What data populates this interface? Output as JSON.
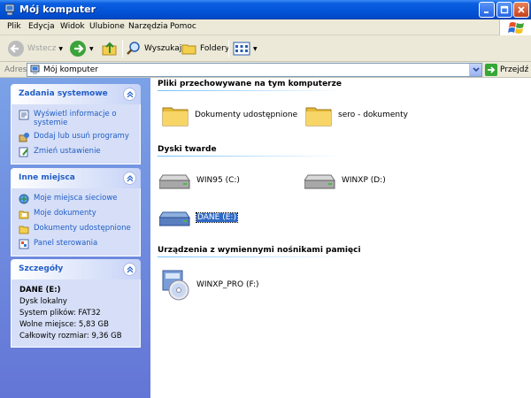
{
  "window": {
    "title": "Mój komputer"
  },
  "menu": {
    "items": [
      "Plik",
      "Edycja",
      "Widok",
      "Ulubione",
      "Narzędzia",
      "Pomoc"
    ]
  },
  "toolbar": {
    "back": "Wstecz",
    "search": "Wyszukaj",
    "folders": "Foldery"
  },
  "address": {
    "label": "Adres",
    "value": "Mój komputer",
    "go": "Przejdź"
  },
  "tasks": {
    "title": "Zadania systemowe",
    "items": [
      {
        "label": "Wyświetl informacje o systemie",
        "icon": "system-info-icon"
      },
      {
        "label": "Dodaj lub usuń programy",
        "icon": "add-remove-programs-icon"
      },
      {
        "label": "Zmień ustawienie",
        "icon": "change-settings-icon"
      }
    ]
  },
  "places": {
    "title": "Inne miejsca",
    "items": [
      {
        "label": "Moje miejsca sieciowe",
        "icon": "network-places-icon"
      },
      {
        "label": "Moje dokumenty",
        "icon": "my-documents-icon"
      },
      {
        "label": "Dokumenty udostępnione",
        "icon": "shared-folder-icon"
      },
      {
        "label": "Panel sterowania",
        "icon": "control-panel-icon"
      }
    ]
  },
  "details": {
    "title": "Szczegóły",
    "name": "DANE (E:)",
    "type": "Dysk lokalny",
    "filesystem": "System plików: FAT32",
    "free": "Wolne miejsce: 5,83 GB",
    "total": "Całkowity rozmiar: 9,36 GB"
  },
  "groups": {
    "stored": {
      "title": "Pliki przechowywane na tym komputerze",
      "items": [
        "Dokumenty udostępnione",
        "sero - dokumenty"
      ]
    },
    "hdd": {
      "title": "Dyski twarde",
      "items": [
        "WIN95 (C:)",
        "WINXP (D:)",
        "DANE (E:)"
      ]
    },
    "removable": {
      "title": "Urządzenia z wymiennymi nośnikami pamięci",
      "items": [
        "WINXP_PRO (F:)"
      ]
    }
  },
  "colors": {
    "titlebar": "#0555d9",
    "leftpanel": "#7ba2e7",
    "link": "#215dc6",
    "selection": "#316ac5"
  }
}
